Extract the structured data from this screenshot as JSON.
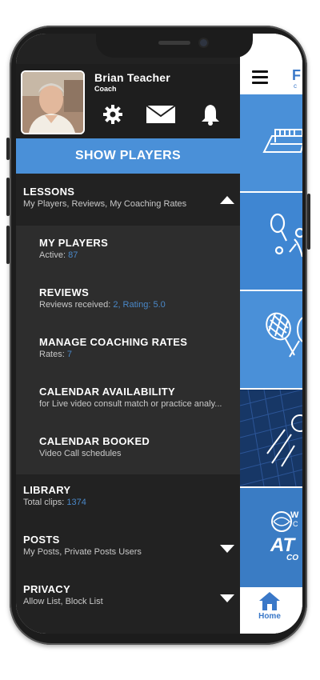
{
  "profile": {
    "name": "Brian Teacher",
    "role": "Coach"
  },
  "icons": [
    "gear-icon",
    "envelope-icon",
    "bell-icon",
    "hamburger-icon",
    "home-icon",
    "tennis-court-icon",
    "tennis-player-icon",
    "crossed-rackets-icon",
    "tennis-ball-icon"
  ],
  "show_players_label": "SHOW PLAYERS",
  "menu": {
    "lessons": {
      "title": "LESSONS",
      "subtitle": "My Players, Reviews, My Coaching Rates",
      "expanded": true,
      "items": [
        {
          "title": "MY PLAYERS",
          "sub_label": "Active:",
          "sub_value": "87"
        },
        {
          "title": "REVIEWS",
          "sub_label": "Reviews received:",
          "sub_value": "2, Rating: 5.0"
        },
        {
          "title": "MANAGE COACHING RATES",
          "sub_label": "Rates:",
          "sub_value": "7"
        },
        {
          "title": "CALENDAR AVAILABILITY",
          "sub_label": "for Live video consult match or practice analy...",
          "sub_value": ""
        },
        {
          "title": "CALENDAR BOOKED",
          "sub_label": "Video Call schedules",
          "sub_value": ""
        }
      ]
    },
    "library": {
      "title": "LIBRARY",
      "sub_label": "Total clips:",
      "sub_value": "1374"
    },
    "posts": {
      "title": "POSTS",
      "subtitle": "My Posts, Private Posts Users",
      "expanded": false
    },
    "privacy": {
      "title": "PRIVACY",
      "subtitle": "Allow List, Block List",
      "expanded": false
    }
  },
  "right_panel": {
    "logo_fragment": "F",
    "logo_fragment_2": "c",
    "tile_text_1": "W",
    "tile_text_2": "C",
    "tile_text_3": "AT",
    "tile_text_4": "CO",
    "home_label": "Home"
  },
  "colors": {
    "accent": "#4a90d8",
    "drawer_bg": "#222222",
    "sub_bg": "#2d2d2d",
    "tile_light": "#4a90d8",
    "tile_mid": "#3a7cc4",
    "tile_dark": "#1e3f7a",
    "number_blue": "#4a88c8"
  }
}
